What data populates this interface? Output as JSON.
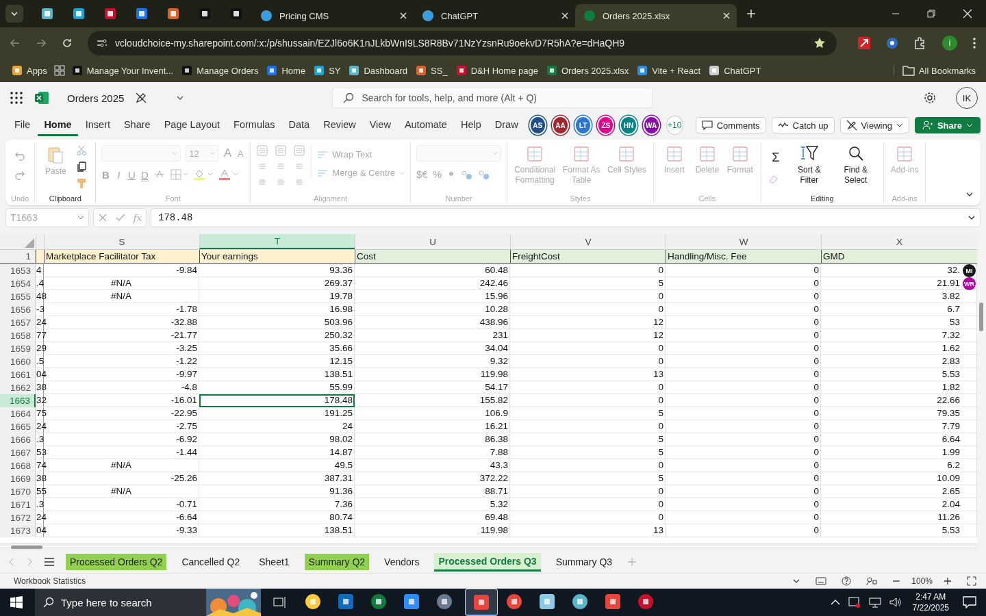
{
  "browser": {
    "tabs": [
      {
        "title": "Pricing CMS",
        "selected": false
      },
      {
        "title": "ChatGPT",
        "selected": false
      },
      {
        "title": "Orders 2025.xlsx",
        "selected": true
      }
    ],
    "address": "vcloudchoice-my.sharepoint.com/:x:/p/shussain/EZJl6o6K1nJLkbWnI9LS8R8Bv71NzYzsnRu9oekvD7R5hA?e=dHaQH9",
    "profile_initial": "i",
    "bookmarks": [
      "Apps",
      "Manage Your Invent...",
      "Manage Orders",
      "Home",
      "SY",
      "Dashboard",
      "SS_",
      "D&H Home page",
      "Orders 2025.xlsx",
      "Vite + React",
      "ChatGPT"
    ],
    "all_bookmarks": "All Bookmarks"
  },
  "excel": {
    "doc_title": "Orders 2025",
    "search_placeholder": "Search for tools, help, and more (Alt + Q)",
    "user_initials": "IK",
    "menu": [
      {
        "label": "File",
        "selected": false
      },
      {
        "label": "Home",
        "selected": true
      },
      {
        "label": "Insert",
        "selected": false
      },
      {
        "label": "Share",
        "selected": false
      },
      {
        "label": "Page Layout",
        "selected": false
      },
      {
        "label": "Formulas",
        "selected": false
      },
      {
        "label": "Data",
        "selected": false
      },
      {
        "label": "Review",
        "selected": false
      },
      {
        "label": "View",
        "selected": false
      },
      {
        "label": "Automate",
        "selected": false
      },
      {
        "label": "Help",
        "selected": false
      },
      {
        "label": "Draw",
        "selected": false
      }
    ],
    "collaborators": [
      {
        "initials": "AS",
        "color": "#1f4e8c"
      },
      {
        "initials": "AA",
        "color": "#a4262c"
      },
      {
        "initials": "LT",
        "color": "#2b78d4"
      },
      {
        "initials": "ZS",
        "color": "#e3008c"
      },
      {
        "initials": "HN",
        "color": "#038387"
      },
      {
        "initials": "WA",
        "color": "#8a0ea8"
      }
    ],
    "more_collaborators": "+10",
    "actions": [
      "Comments",
      "Catch up",
      "Viewing",
      "Share"
    ],
    "ribbon": [
      {
        "kind": "undo",
        "label": "Undo",
        "disabled": true
      },
      {
        "kind": "clipboard",
        "label": "Clipboard",
        "disabled": false,
        "buttons": [
          {
            "label": "Paste",
            "disabled": true
          }
        ]
      },
      {
        "kind": "font",
        "label": "Font",
        "disabled": true,
        "font_size": "12",
        "grow": "A",
        "shrink": "A",
        "styles": [
          "B",
          "I",
          "U",
          "D"
        ]
      },
      {
        "kind": "alignment",
        "label": "Alignment",
        "disabled": true,
        "buttons": [
          {
            "label": "Wrap Text",
            "disabled": true
          },
          {
            "label": "Merge & Centre",
            "disabled": true
          }
        ]
      },
      {
        "kind": "number",
        "label": "Number",
        "disabled": true,
        "currency": "$€",
        "percent": "%"
      },
      {
        "kind": "large",
        "label": "Styles",
        "disabled": true,
        "buttons": [
          {
            "label": "Conditional Formatting",
            "disabled": true
          },
          {
            "label": "Format As Table",
            "disabled": true
          },
          {
            "label": "Cell Styles",
            "disabled": true
          }
        ]
      },
      {
        "kind": "large",
        "label": "Cells",
        "disabled": true,
        "buttons": [
          {
            "label": "Insert",
            "disabled": true
          },
          {
            "label": "Delete",
            "disabled": true
          },
          {
            "label": "Format",
            "disabled": true
          }
        ]
      },
      {
        "kind": "editing",
        "label": "Editing",
        "disabled": false,
        "autosum": "Σ",
        "buttons": [
          {
            "label": "Sort & Filter",
            "disabled": false
          },
          {
            "label": "Find & Select",
            "disabled": false
          }
        ]
      },
      {
        "kind": "large",
        "label": "Add-ins",
        "disabled": true,
        "buttons": [
          {
            "label": "Add-ins",
            "disabled": true
          }
        ]
      }
    ],
    "formula_bar": {
      "name_box": "T1663",
      "fx": "fx",
      "value": "178.48"
    },
    "sheet": {
      "first_row_number": "1",
      "partial_column": {
        "color": "#fff2cc"
      },
      "columns": [
        {
          "letter": "S",
          "header": "Marketplace Facilitator Tax",
          "color": "#fff2cc",
          "selected": false
        },
        {
          "letter": "T",
          "header": "Your earnings",
          "color": "#fff2cc",
          "selected": true
        },
        {
          "letter": "U",
          "header": "Cost",
          "color": "#e2efda",
          "selected": false
        },
        {
          "letter": "V",
          "header": "FreightCost",
          "color": "#e2efda",
          "selected": false
        },
        {
          "letter": "W",
          "header": "Handling/Misc. Fee",
          "color": "#e2efda",
          "selected": false
        },
        {
          "letter": "X",
          "header": "GMD",
          "color": "#e2efda",
          "selected": false
        }
      ],
      "presence": [
        {
          "initials": "MI",
          "color": "#1b1b1b"
        },
        {
          "initials": "WR",
          "color": "#b4009e"
        }
      ],
      "rows": [
        {
          "number": "1653",
          "partial": "4",
          "selected": false,
          "cells": [
            "-9.84",
            "93.36",
            "60.48",
            "0",
            "0",
            "32."
          ]
        },
        {
          "number": "1654",
          "partial": ".4",
          "selected": false,
          "cells": [
            {
              "text": "#N/A",
              "kind": "error"
            },
            "269.37",
            "242.46",
            "5",
            "0",
            "21.91"
          ]
        },
        {
          "number": "1655",
          "partial": "48",
          "selected": false,
          "cells": [
            {
              "text": "#N/A",
              "kind": "error"
            },
            "19.78",
            "15.96",
            "0",
            "0",
            "3.82"
          ]
        },
        {
          "number": "1656",
          "partial": "-3",
          "selected": false,
          "cells": [
            "-1.78",
            "16.98",
            "10.28",
            "0",
            "0",
            "6.7"
          ]
        },
        {
          "number": "1657",
          "partial": "24",
          "selected": false,
          "cells": [
            "-32.88",
            "503.96",
            "438.96",
            "12",
            "0",
            "53"
          ]
        },
        {
          "number": "1658",
          "partial": "77",
          "selected": false,
          "cells": [
            "-21.77",
            "250.32",
            "231",
            "12",
            "0",
            "7.32"
          ]
        },
        {
          "number": "1659",
          "partial": "29",
          "selected": false,
          "cells": [
            "-3.25",
            "35.66",
            "34.04",
            "0",
            "0",
            "1.62"
          ]
        },
        {
          "number": "1660",
          "partial": ".5",
          "selected": false,
          "cells": [
            "-1.22",
            "12.15",
            "9.32",
            "0",
            "0",
            "2.83"
          ]
        },
        {
          "number": "1661",
          "partial": "04",
          "selected": false,
          "cells": [
            "-9.97",
            "138.51",
            "119.98",
            "13",
            "0",
            "5.53"
          ]
        },
        {
          "number": "1662",
          "partial": "38",
          "selected": false,
          "cells": [
            "-4.8",
            "55.99",
            "54.17",
            "0",
            "0",
            "1.82"
          ]
        },
        {
          "number": "1663",
          "partial": "32",
          "selected": true,
          "cells": [
            "-16.01",
            "178.48",
            "155.82",
            "0",
            "0",
            "22.66"
          ]
        },
        {
          "number": "1664",
          "partial": "75",
          "selected": false,
          "cells": [
            "-22.95",
            "191.25",
            "106.9",
            "5",
            "0",
            "79.35"
          ]
        },
        {
          "number": "1665",
          "partial": "24",
          "selected": false,
          "cells": [
            "-2.75",
            "24",
            "16.21",
            "0",
            "0",
            "7.79"
          ]
        },
        {
          "number": "1666",
          "partial": ".3",
          "selected": false,
          "cells": [
            "-6.92",
            "98.02",
            "86.38",
            "5",
            "0",
            "6.64"
          ]
        },
        {
          "number": "1667",
          "partial": "53",
          "selected": false,
          "cells": [
            "-1.44",
            "14.87",
            "7.88",
            "5",
            "0",
            "1.99"
          ]
        },
        {
          "number": "1668",
          "partial": "74",
          "selected": false,
          "cells": [
            {
              "text": "#N/A",
              "kind": "error"
            },
            "49.5",
            "43.3",
            "0",
            "0",
            "6.2"
          ]
        },
        {
          "number": "1669",
          "partial": "38",
          "selected": false,
          "cells": [
            "-25.26",
            "387.31",
            "372.22",
            "5",
            "0",
            "10.09"
          ]
        },
        {
          "number": "1670",
          "partial": "55",
          "selected": false,
          "cells": [
            {
              "text": "#N/A",
              "kind": "error"
            },
            "91.36",
            "88.71",
            "0",
            "0",
            "2.65"
          ]
        },
        {
          "number": "1671",
          "partial": ".3",
          "selected": false,
          "cells": [
            "-0.71",
            "7.36",
            "5.32",
            "0",
            "0",
            "2.04"
          ]
        },
        {
          "number": "1672",
          "partial": "24",
          "selected": false,
          "cells": [
            "-6.64",
            "80.74",
            "69.48",
            "0",
            "0",
            "11.26"
          ]
        },
        {
          "number": "1673",
          "partial": "04",
          "selected": false,
          "cells": [
            "-9.33",
            "138.51",
            "119.98",
            "13",
            "0",
            "5.53"
          ]
        }
      ]
    },
    "sheet_tabs": [
      {
        "label": "Processed Orders Q2",
        "selected": false,
        "color": "#92d050"
      },
      {
        "label": "Cancelled Q2",
        "selected": false
      },
      {
        "label": "Sheet1",
        "selected": false
      },
      {
        "label": "Summary Q2",
        "selected": false,
        "color": "#92d050"
      },
      {
        "label": "Vendors",
        "selected": false
      },
      {
        "label": "Processed Orders Q3",
        "selected": true
      },
      {
        "label": "Summary Q3",
        "selected": false
      }
    ],
    "status_bar": {
      "left": "Workbook Statistics",
      "zoom": "100%"
    }
  },
  "taskbar": {
    "search_placeholder": "Type here to search",
    "time": "2:47 AM",
    "date": "7/22/2025"
  }
}
